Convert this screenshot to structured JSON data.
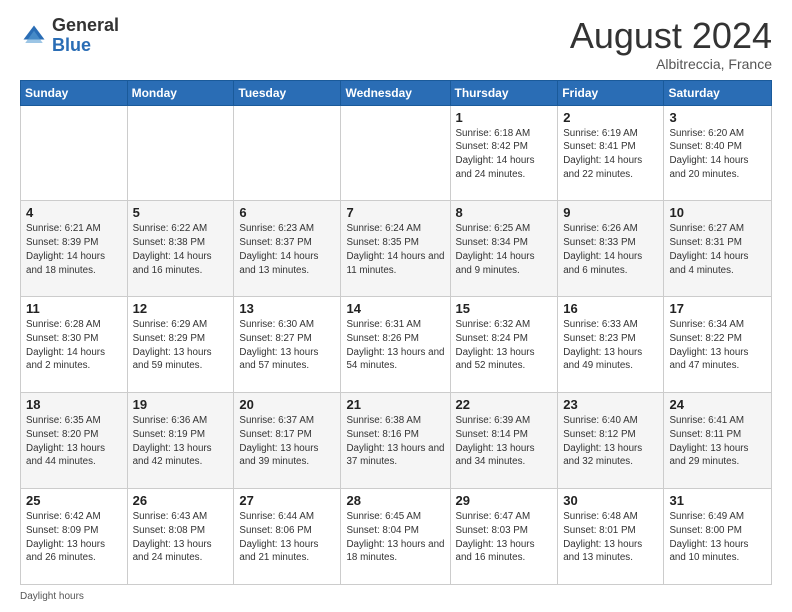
{
  "logo": {
    "line1": "General",
    "line2": "Blue"
  },
  "title": {
    "month_year": "August 2024",
    "location": "Albitreccia, France"
  },
  "days_of_week": [
    "Sunday",
    "Monday",
    "Tuesday",
    "Wednesday",
    "Thursday",
    "Friday",
    "Saturday"
  ],
  "footer": {
    "label": "Daylight hours"
  },
  "weeks": [
    [
      {
        "day": "",
        "sunrise": "",
        "sunset": "",
        "daylight": ""
      },
      {
        "day": "",
        "sunrise": "",
        "sunset": "",
        "daylight": ""
      },
      {
        "day": "",
        "sunrise": "",
        "sunset": "",
        "daylight": ""
      },
      {
        "day": "",
        "sunrise": "",
        "sunset": "",
        "daylight": ""
      },
      {
        "day": "1",
        "sunrise": "Sunrise: 6:18 AM",
        "sunset": "Sunset: 8:42 PM",
        "daylight": "Daylight: 14 hours and 24 minutes."
      },
      {
        "day": "2",
        "sunrise": "Sunrise: 6:19 AM",
        "sunset": "Sunset: 8:41 PM",
        "daylight": "Daylight: 14 hours and 22 minutes."
      },
      {
        "day": "3",
        "sunrise": "Sunrise: 6:20 AM",
        "sunset": "Sunset: 8:40 PM",
        "daylight": "Daylight: 14 hours and 20 minutes."
      }
    ],
    [
      {
        "day": "4",
        "sunrise": "Sunrise: 6:21 AM",
        "sunset": "Sunset: 8:39 PM",
        "daylight": "Daylight: 14 hours and 18 minutes."
      },
      {
        "day": "5",
        "sunrise": "Sunrise: 6:22 AM",
        "sunset": "Sunset: 8:38 PM",
        "daylight": "Daylight: 14 hours and 16 minutes."
      },
      {
        "day": "6",
        "sunrise": "Sunrise: 6:23 AM",
        "sunset": "Sunset: 8:37 PM",
        "daylight": "Daylight: 14 hours and 13 minutes."
      },
      {
        "day": "7",
        "sunrise": "Sunrise: 6:24 AM",
        "sunset": "Sunset: 8:35 PM",
        "daylight": "Daylight: 14 hours and 11 minutes."
      },
      {
        "day": "8",
        "sunrise": "Sunrise: 6:25 AM",
        "sunset": "Sunset: 8:34 PM",
        "daylight": "Daylight: 14 hours and 9 minutes."
      },
      {
        "day": "9",
        "sunrise": "Sunrise: 6:26 AM",
        "sunset": "Sunset: 8:33 PM",
        "daylight": "Daylight: 14 hours and 6 minutes."
      },
      {
        "day": "10",
        "sunrise": "Sunrise: 6:27 AM",
        "sunset": "Sunset: 8:31 PM",
        "daylight": "Daylight: 14 hours and 4 minutes."
      }
    ],
    [
      {
        "day": "11",
        "sunrise": "Sunrise: 6:28 AM",
        "sunset": "Sunset: 8:30 PM",
        "daylight": "Daylight: 14 hours and 2 minutes."
      },
      {
        "day": "12",
        "sunrise": "Sunrise: 6:29 AM",
        "sunset": "Sunset: 8:29 PM",
        "daylight": "Daylight: 13 hours and 59 minutes."
      },
      {
        "day": "13",
        "sunrise": "Sunrise: 6:30 AM",
        "sunset": "Sunset: 8:27 PM",
        "daylight": "Daylight: 13 hours and 57 minutes."
      },
      {
        "day": "14",
        "sunrise": "Sunrise: 6:31 AM",
        "sunset": "Sunset: 8:26 PM",
        "daylight": "Daylight: 13 hours and 54 minutes."
      },
      {
        "day": "15",
        "sunrise": "Sunrise: 6:32 AM",
        "sunset": "Sunset: 8:24 PM",
        "daylight": "Daylight: 13 hours and 52 minutes."
      },
      {
        "day": "16",
        "sunrise": "Sunrise: 6:33 AM",
        "sunset": "Sunset: 8:23 PM",
        "daylight": "Daylight: 13 hours and 49 minutes."
      },
      {
        "day": "17",
        "sunrise": "Sunrise: 6:34 AM",
        "sunset": "Sunset: 8:22 PM",
        "daylight": "Daylight: 13 hours and 47 minutes."
      }
    ],
    [
      {
        "day": "18",
        "sunrise": "Sunrise: 6:35 AM",
        "sunset": "Sunset: 8:20 PM",
        "daylight": "Daylight: 13 hours and 44 minutes."
      },
      {
        "day": "19",
        "sunrise": "Sunrise: 6:36 AM",
        "sunset": "Sunset: 8:19 PM",
        "daylight": "Daylight: 13 hours and 42 minutes."
      },
      {
        "day": "20",
        "sunrise": "Sunrise: 6:37 AM",
        "sunset": "Sunset: 8:17 PM",
        "daylight": "Daylight: 13 hours and 39 minutes."
      },
      {
        "day": "21",
        "sunrise": "Sunrise: 6:38 AM",
        "sunset": "Sunset: 8:16 PM",
        "daylight": "Daylight: 13 hours and 37 minutes."
      },
      {
        "day": "22",
        "sunrise": "Sunrise: 6:39 AM",
        "sunset": "Sunset: 8:14 PM",
        "daylight": "Daylight: 13 hours and 34 minutes."
      },
      {
        "day": "23",
        "sunrise": "Sunrise: 6:40 AM",
        "sunset": "Sunset: 8:12 PM",
        "daylight": "Daylight: 13 hours and 32 minutes."
      },
      {
        "day": "24",
        "sunrise": "Sunrise: 6:41 AM",
        "sunset": "Sunset: 8:11 PM",
        "daylight": "Daylight: 13 hours and 29 minutes."
      }
    ],
    [
      {
        "day": "25",
        "sunrise": "Sunrise: 6:42 AM",
        "sunset": "Sunset: 8:09 PM",
        "daylight": "Daylight: 13 hours and 26 minutes."
      },
      {
        "day": "26",
        "sunrise": "Sunrise: 6:43 AM",
        "sunset": "Sunset: 8:08 PM",
        "daylight": "Daylight: 13 hours and 24 minutes."
      },
      {
        "day": "27",
        "sunrise": "Sunrise: 6:44 AM",
        "sunset": "Sunset: 8:06 PM",
        "daylight": "Daylight: 13 hours and 21 minutes."
      },
      {
        "day": "28",
        "sunrise": "Sunrise: 6:45 AM",
        "sunset": "Sunset: 8:04 PM",
        "daylight": "Daylight: 13 hours and 18 minutes."
      },
      {
        "day": "29",
        "sunrise": "Sunrise: 6:47 AM",
        "sunset": "Sunset: 8:03 PM",
        "daylight": "Daylight: 13 hours and 16 minutes."
      },
      {
        "day": "30",
        "sunrise": "Sunrise: 6:48 AM",
        "sunset": "Sunset: 8:01 PM",
        "daylight": "Daylight: 13 hours and 13 minutes."
      },
      {
        "day": "31",
        "sunrise": "Sunrise: 6:49 AM",
        "sunset": "Sunset: 8:00 PM",
        "daylight": "Daylight: 13 hours and 10 minutes."
      }
    ]
  ]
}
